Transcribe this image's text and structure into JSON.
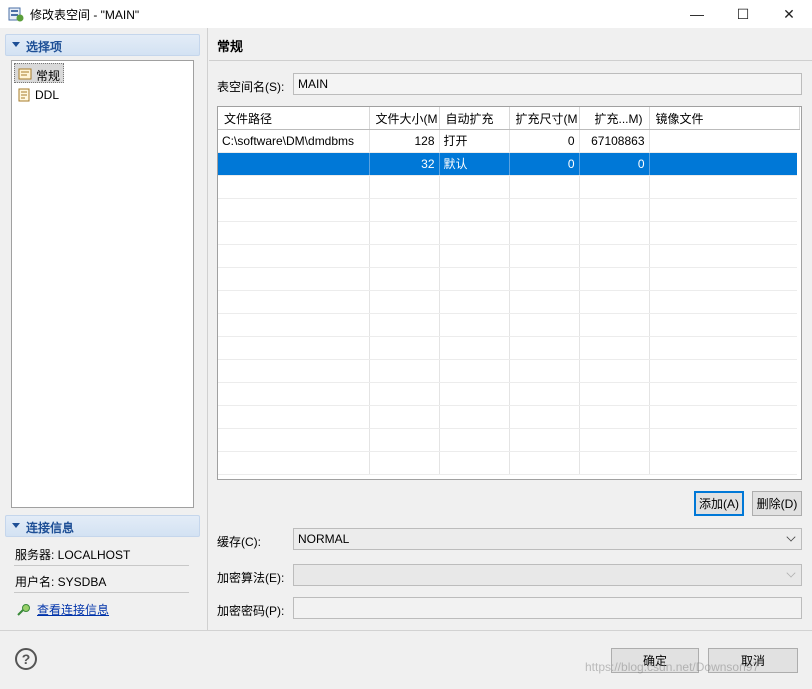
{
  "window": {
    "title": "修改表空间 - \"MAIN\"",
    "minimize_glyph": "—",
    "maximize_glyph": "☐",
    "close_glyph": "✕"
  },
  "sidebar": {
    "section_title": "选择项",
    "items": [
      {
        "label": "常规",
        "icon": "general-settings-icon",
        "selected": true
      },
      {
        "label": "DDL",
        "icon": "ddl-document-icon",
        "selected": false
      }
    ]
  },
  "connection": {
    "section_title": "连接信息",
    "server": "服务器: LOCALHOST",
    "user": "用户名: SYSDBA",
    "view_link": "查看连接信息"
  },
  "page": {
    "title": "常规",
    "tablespace_name_label": "表空间名(S):",
    "tablespace_name_value": "MAIN"
  },
  "file_table": {
    "columns": [
      "文件路径",
      "文件大小(M",
      "自动扩充",
      "扩充尺寸(M",
      "扩充...M)",
      "镜像文件"
    ],
    "rows": [
      [
        "C:\\software\\DM\\dmdbms",
        "128",
        "打开",
        "0",
        "67108863",
        ""
      ],
      [
        "",
        "32",
        "默认",
        "0",
        "0",
        ""
      ]
    ],
    "selected_row": 1,
    "empty_rows": 13
  },
  "actions": {
    "add": "添加(A)",
    "delete": "删除(D)"
  },
  "cache": {
    "label": "缓存(C):",
    "value": "NORMAL"
  },
  "encrypt_algo": {
    "label": "加密算法(E):",
    "value": ""
  },
  "encrypt_pwd": {
    "label": "加密密码(P):",
    "value": ""
  },
  "footer": {
    "help": "?",
    "ok": "确定",
    "cancel": "取消",
    "watermark": "https://blog.csdn.net/Downson97"
  },
  "colors": {
    "selection": "#0078d7",
    "section_header_text": "#1e4f96",
    "link": "#0033aa"
  }
}
